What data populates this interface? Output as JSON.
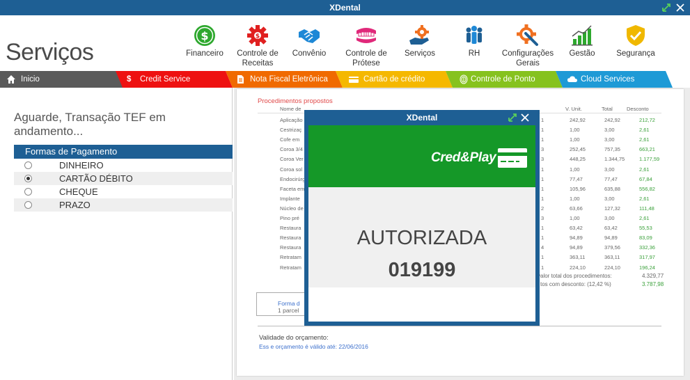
{
  "window": {
    "title": "XDental"
  },
  "header": {
    "app_title": "Serviços"
  },
  "modules": [
    {
      "label": "Financeiro",
      "icon": "dollar-icon",
      "color": "#2ea82e"
    },
    {
      "label": "Controle de Receitas",
      "icon": "gear-icon",
      "color": "#e02020"
    },
    {
      "label": "Convênio",
      "icon": "handshake-icon",
      "color": "#1e88d6"
    },
    {
      "label": "Controle de Prótese",
      "icon": "denture-icon",
      "color": "#e0287a"
    },
    {
      "label": "Serviços",
      "icon": "service-gear-icon",
      "color": "#f07020"
    },
    {
      "label": "RH",
      "icon": "people-icon",
      "color": "#1e5f94"
    },
    {
      "label": "Configurações Gerais",
      "icon": "wrench-gear-icon",
      "color": "#f07020"
    },
    {
      "label": "Gestão",
      "icon": "bar-chart-icon",
      "color": "#2ea82e"
    },
    {
      "label": "Segurança",
      "icon": "shield-icon",
      "color": "#f0b800"
    }
  ],
  "tabs": [
    {
      "label": "Inicio",
      "color": "#5a5a5a"
    },
    {
      "label": "Credit Service",
      "color": "#ee1111"
    },
    {
      "label": "Nota Fiscal Eletrônica",
      "color": "#f06a00"
    },
    {
      "label": "Cartão de crédito",
      "color": "#f5b800"
    },
    {
      "label": "Controle de Ponto",
      "color": "#86c21e"
    },
    {
      "label": "Cloud Services",
      "color": "#1e9ad6"
    }
  ],
  "left": {
    "status_message": "Aguarde, Transação TEF em andamento...",
    "payment_header": "Formas de Pagamento",
    "payment_options": [
      {
        "label": "DINHEIRO",
        "selected": false
      },
      {
        "label": "CARTÃO DÉBITO",
        "selected": true
      },
      {
        "label": "CHEQUE",
        "selected": false
      },
      {
        "label": "PRAZO",
        "selected": false
      }
    ]
  },
  "document": {
    "title": "Procedimentos propostos",
    "col_name": "Nome de",
    "col_unit": "V. Unit.",
    "col_total": "Total",
    "col_discount": "Desconto",
    "rows": [
      {
        "name": "Aplicação",
        "qty": "1",
        "unit": "242,92",
        "total": "242,92",
        "disc": "212,72"
      },
      {
        "name": "Cestrizaç",
        "qty": "1",
        "unit": "1,00",
        "total": "3,00",
        "disc": "2,61"
      },
      {
        "name": "Cofe em",
        "qty": "1",
        "unit": "1,00",
        "total": "3,00",
        "disc": "2,61"
      },
      {
        "name": "Coroa 3/4",
        "qty": "3",
        "unit": "252,45",
        "total": "757,35",
        "disc": "663,21"
      },
      {
        "name": "Coroa Ver",
        "qty": "3",
        "unit": "448,25",
        "total": "1.344,75",
        "disc": "1.177,59"
      },
      {
        "name": "Coroa sol",
        "qty": "1",
        "unit": "1,00",
        "total": "3,00",
        "disc": "2,61"
      },
      {
        "name": "Endocirúrg",
        "qty": "1",
        "unit": "77,47",
        "total": "77,47",
        "disc": "67,84"
      },
      {
        "name": "Faceta em",
        "qty": "1",
        "unit": "105,96",
        "total": "635,88",
        "disc": "556,82"
      },
      {
        "name": "Implante",
        "qty": "1",
        "unit": "1,00",
        "total": "3,00",
        "disc": "2,61"
      },
      {
        "name": "Núcleo de",
        "qty": "2",
        "unit": "63,66",
        "total": "127,32",
        "disc": "111,48"
      },
      {
        "name": "Pino pré",
        "qty": "3",
        "unit": "1,00",
        "total": "3,00",
        "disc": "2,61"
      },
      {
        "name": "Restaura",
        "qty": "1",
        "unit": "63,42",
        "total": "63,42",
        "disc": "55,53"
      },
      {
        "name": "Restaura",
        "qty": "1",
        "unit": "94,89",
        "total": "94,89",
        "disc": "83,09"
      },
      {
        "name": "Restaura",
        "qty": "4",
        "unit": "94,89",
        "total": "379,56",
        "disc": "332,36"
      },
      {
        "name": "Retratam",
        "qty": "1",
        "unit": "363,11",
        "total": "363,11",
        "disc": "317,97"
      },
      {
        "name": "Retratam",
        "qty": "1",
        "unit": "224,10",
        "total": "224,10",
        "disc": "196,24"
      }
    ],
    "total_label": "valor total dos procedimentos:",
    "total_value": "4.329,77",
    "discount_label": "tos com desconto: (12,42 %)",
    "discount_value": "3.787,98",
    "forma_label": "Forma d",
    "forma_sub": "1 parcel",
    "validity_label": "Validade do orçamento:",
    "validity_text": "Ess e orçamento é válido até: 22/06/2016"
  },
  "modal": {
    "title": "XDental",
    "brand": "Cred&Play",
    "brand_color": "#159828",
    "status": "AUTORIZADA",
    "code": "019199"
  }
}
